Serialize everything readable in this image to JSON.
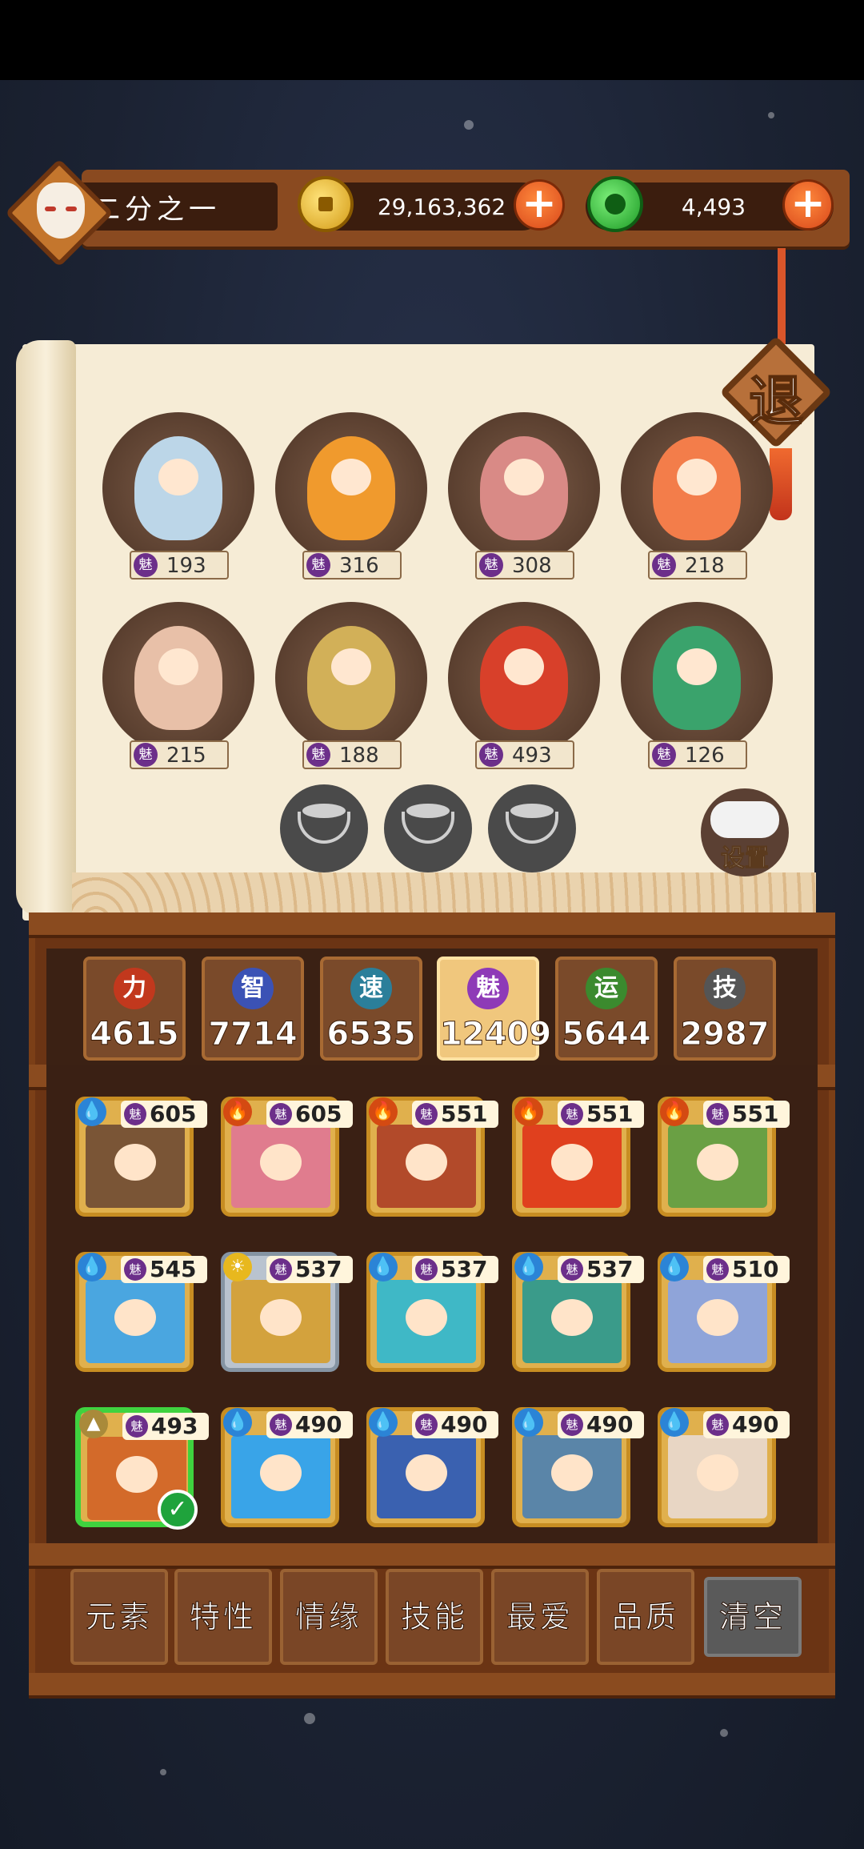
{
  "header": {
    "player_name": "二分之一",
    "coins": "29,163,362",
    "gems": "4,493",
    "add_coins": "+",
    "add_gems": "+"
  },
  "exit_label": "退",
  "settings_label": "设置",
  "team": [
    {
      "charm_icon": "魅",
      "value": "193",
      "color": "#bcd6e8"
    },
    {
      "charm_icon": "魅",
      "value": "316",
      "color": "#f09a2d"
    },
    {
      "charm_icon": "魅",
      "value": "308",
      "color": "#d98a86"
    },
    {
      "charm_icon": "魅",
      "value": "218",
      "color": "#f37d4a"
    },
    {
      "charm_icon": "魅",
      "value": "215",
      "color": "#e8c0a8"
    },
    {
      "charm_icon": "魅",
      "value": "188",
      "color": "#d2b058"
    },
    {
      "charm_icon": "魅",
      "value": "493",
      "color": "#d8402a"
    },
    {
      "charm_icon": "魅",
      "value": "126",
      "color": "#3aa36c"
    }
  ],
  "stats": [
    {
      "icon": "力",
      "value": "4615",
      "color": "#c2381d"
    },
    {
      "icon": "智",
      "value": "7714",
      "color": "#3b52b5"
    },
    {
      "icon": "速",
      "value": "6535",
      "color": "#2b7f9a"
    },
    {
      "icon": "魅",
      "value": "12409",
      "color": "#8e3ab7",
      "active": true
    },
    {
      "icon": "运",
      "value": "5644",
      "color": "#3b8a2e"
    },
    {
      "icon": "技",
      "value": "2987",
      "color": "#555555"
    }
  ],
  "cards": [
    {
      "element": "water",
      "element_icon": "💧",
      "charm_icon": "魅",
      "value": "605",
      "color": "#7a5536"
    },
    {
      "element": "fire",
      "element_icon": "🔥",
      "charm_icon": "魅",
      "value": "605",
      "color": "#e07c8e"
    },
    {
      "element": "fire",
      "element_icon": "🔥",
      "charm_icon": "魅",
      "value": "551",
      "color": "#b24a2a"
    },
    {
      "element": "fire",
      "element_icon": "🔥",
      "charm_icon": "魅",
      "value": "551",
      "color": "#e0401e"
    },
    {
      "element": "fire",
      "element_icon": "🔥",
      "charm_icon": "魅",
      "value": "551",
      "color": "#6aa044"
    },
    {
      "element": "water",
      "element_icon": "💧",
      "charm_icon": "魅",
      "value": "545",
      "color": "#4aa6e0"
    },
    {
      "element": "sun",
      "element_icon": "☀",
      "charm_icon": "魅",
      "value": "537",
      "color": "#d3a23d",
      "silver": true
    },
    {
      "element": "water",
      "element_icon": "💧",
      "charm_icon": "魅",
      "value": "537",
      "color": "#3fb8c6"
    },
    {
      "element": "water",
      "element_icon": "💧",
      "charm_icon": "魅",
      "value": "537",
      "color": "#3a9b8a"
    },
    {
      "element": "water",
      "element_icon": "💧",
      "charm_icon": "魅",
      "value": "510",
      "color": "#8fa4d9"
    },
    {
      "element": "earth",
      "element_icon": "▲",
      "charm_icon": "魅",
      "value": "493",
      "color": "#d36a2a",
      "selected": true,
      "check": "✓"
    },
    {
      "element": "water",
      "element_icon": "💧",
      "charm_icon": "魅",
      "value": "490",
      "color": "#39a4e8"
    },
    {
      "element": "water",
      "element_icon": "💧",
      "charm_icon": "魅",
      "value": "490",
      "color": "#3a61b0"
    },
    {
      "element": "water",
      "element_icon": "💧",
      "charm_icon": "魅",
      "value": "490",
      "color": "#5a85a8"
    },
    {
      "element": "water",
      "element_icon": "💧",
      "charm_icon": "魅",
      "value": "490",
      "color": "#e8d6c4"
    }
  ],
  "filters": [
    "元素",
    "特性",
    "情缘",
    "技能",
    "最爱",
    "品质",
    "清空"
  ]
}
